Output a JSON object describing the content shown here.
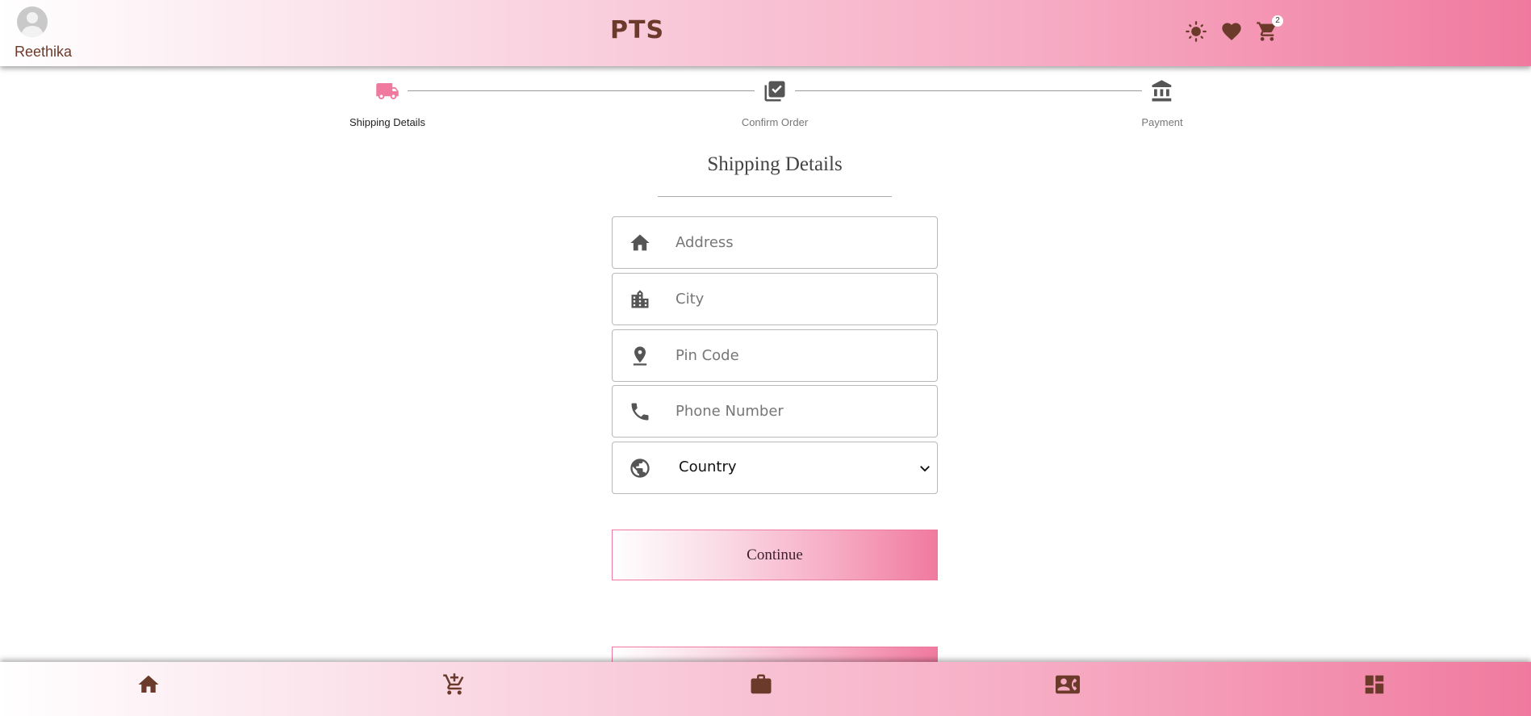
{
  "header": {
    "username": "Reethika",
    "brand": "PTS",
    "cart_count": "2",
    "icons": [
      "avatar-icon",
      "theme-sun-icon",
      "heart-icon",
      "cart-icon"
    ]
  },
  "stepper": {
    "steps": [
      {
        "label": "Shipping Details",
        "icon": "truck-icon",
        "active": true
      },
      {
        "label": "Confirm Order",
        "icon": "library-check-icon",
        "active": false
      },
      {
        "label": "Payment",
        "icon": "bank-icon",
        "active": false
      }
    ]
  },
  "form": {
    "title": "Shipping Details",
    "address_placeholder": "Address",
    "city_placeholder": "City",
    "pincode_placeholder": "Pin Code",
    "phone_placeholder": "Phone Number",
    "country_value": "Country",
    "continue_label": "Continue"
  },
  "bottom_nav": {
    "icons": [
      "home-icon",
      "add-to-cart-icon",
      "briefcase-icon",
      "contact-card-icon",
      "dashboard-icon"
    ]
  },
  "colors": {
    "accent": "#f07a9f",
    "brown": "#6b3a2a",
    "active_step": "#f07a9f"
  }
}
